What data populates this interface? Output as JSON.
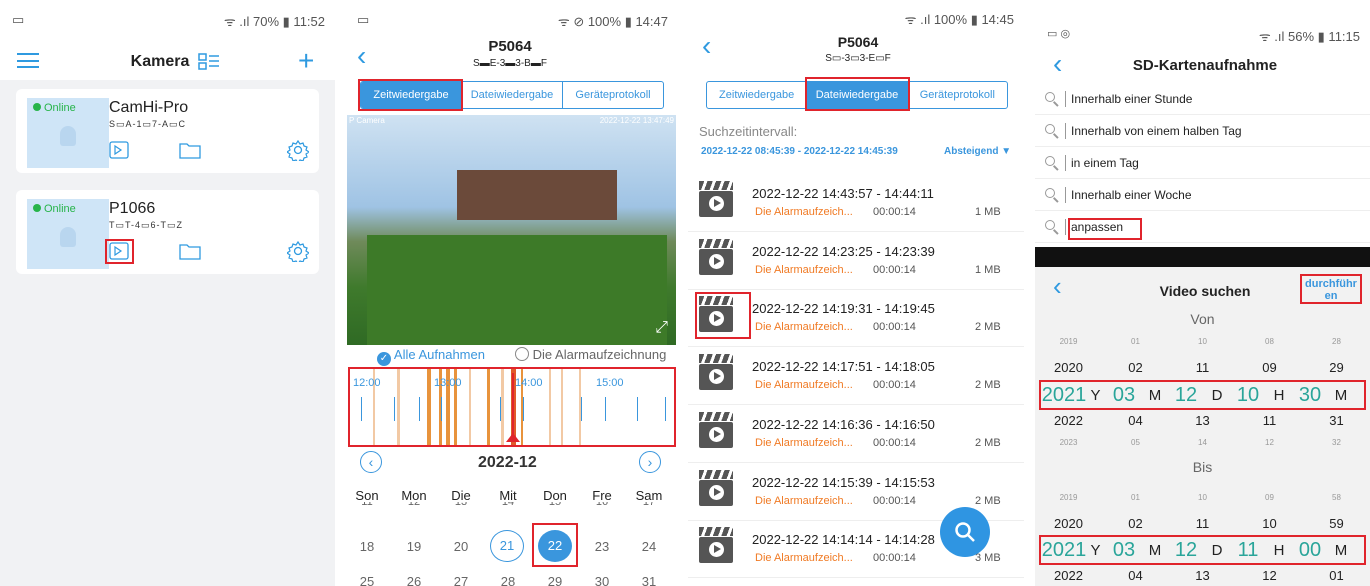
{
  "screen1": {
    "status_left": "▭",
    "status_right": "ᯤ .ıl 70% ▮ 11:52",
    "title": "Kamera",
    "cameras": [
      {
        "name": "CamHi-Pro",
        "status": "Online",
        "serial": "S▭A-1▭7-A▭C"
      },
      {
        "name": "P1066",
        "status": "Online",
        "serial": "T▭T-4▭6-T▭Z"
      }
    ]
  },
  "screen2": {
    "status_left": "▭",
    "status_right": "ᯤ ⊘ 100% ▮ 14:47",
    "title": "P5064",
    "subtitle": "S▬E-3▬3-B▬F",
    "tabs": [
      "Zeitwiedergabe",
      "Dateiwiedergabe",
      "Geräteprotokoll"
    ],
    "overlay_left": "P Camera",
    "overlay_right": "2022-12-22 13:47:49",
    "radio_all": "Alle Aufnahmen",
    "radio_alarm": "Die Alarmaufzeichnung",
    "timeline_labels": [
      "12:00",
      "13:00",
      "14:00",
      "15:00"
    ],
    "month": "2022-12",
    "weekdays": [
      "Son",
      "Mon",
      "Die",
      "Mit",
      "Don",
      "Fre",
      "Sam"
    ],
    "week_prev": [
      "11",
      "12",
      "13",
      "14",
      "15",
      "16",
      "17"
    ],
    "week1": [
      "18",
      "19",
      "20",
      "21",
      "22",
      "23",
      "24"
    ],
    "week2": [
      "25",
      "26",
      "27",
      "28",
      "29",
      "30",
      "31"
    ]
  },
  "screen3": {
    "status_right": "ᯤ .ıl 100% ▮ 14:45",
    "title": "P5064",
    "subtitle": "S▭-3▭3-E▭F",
    "tabs": [
      "Zeitwiedergabe",
      "Dateiwiedergabe",
      "Geräteprotokoll"
    ],
    "interval_label": "Suchzeitintervall:",
    "interval": "2022-12-22 08:45:39 - 2022-12-22 14:45:39",
    "sort": "Absteigend ▼",
    "records": [
      {
        "time": "2022-12-22 14:43:57 - 14:44:11",
        "type": "Die Alarmaufzeich...",
        "dur": "00:00:14",
        "size": "1 MB"
      },
      {
        "time": "2022-12-22 14:23:25 - 14:23:39",
        "type": "Die Alarmaufzeich...",
        "dur": "00:00:14",
        "size": "1 MB"
      },
      {
        "time": "2022-12-22 14:19:31 - 14:19:45",
        "type": "Die Alarmaufzeich...",
        "dur": "00:00:14",
        "size": "2 MB"
      },
      {
        "time": "2022-12-22 14:17:51 - 14:18:05",
        "type": "Die Alarmaufzeich...",
        "dur": "00:00:14",
        "size": "2 MB"
      },
      {
        "time": "2022-12-22 14:16:36 - 14:16:50",
        "type": "Die Alarmaufzeich...",
        "dur": "00:00:14",
        "size": "2 MB"
      },
      {
        "time": "2022-12-22 14:15:39 - 14:15:53",
        "type": "Die Alarmaufzeich...",
        "dur": "00:00:14",
        "size": "2 MB"
      },
      {
        "time": "2022-12-22 14:14:14 - 14:14:28",
        "type": "Die Alarmaufzeich...",
        "dur": "00:00:14",
        "size": "3 MB"
      }
    ]
  },
  "screen4": {
    "status_right": "ᯤ .ıl 56% ▮ 11:15",
    "title": "SD-Kartenaufnahme",
    "options": [
      "Innerhalb einer Stunde",
      "Innerhalb von einem halben Tag",
      "in einem Tag",
      "Innerhalb einer Woche",
      "anpassen"
    ],
    "picker_title": "Video suchen",
    "picker_action": "durchführen",
    "from_label": "Von",
    "to_label": "Bis",
    "from_rows": [
      [
        "2019",
        "01",
        "10",
        "08",
        "28"
      ],
      [
        "2020",
        "02",
        "11",
        "09",
        "29"
      ],
      [
        "2021",
        "03",
        "12",
        "10",
        "30"
      ],
      [
        "2022",
        "04",
        "13",
        "11",
        "31"
      ],
      [
        "2023",
        "05",
        "14",
        "12",
        "32"
      ]
    ],
    "to_rows": [
      [
        "2019",
        "01",
        "10",
        "09",
        "58"
      ],
      [
        "2020",
        "02",
        "11",
        "10",
        "59"
      ],
      [
        "2021",
        "03",
        "12",
        "11",
        "00"
      ],
      [
        "2022",
        "04",
        "13",
        "12",
        "01"
      ]
    ],
    "units": [
      "Y",
      "M",
      "D",
      "H",
      "M"
    ]
  }
}
